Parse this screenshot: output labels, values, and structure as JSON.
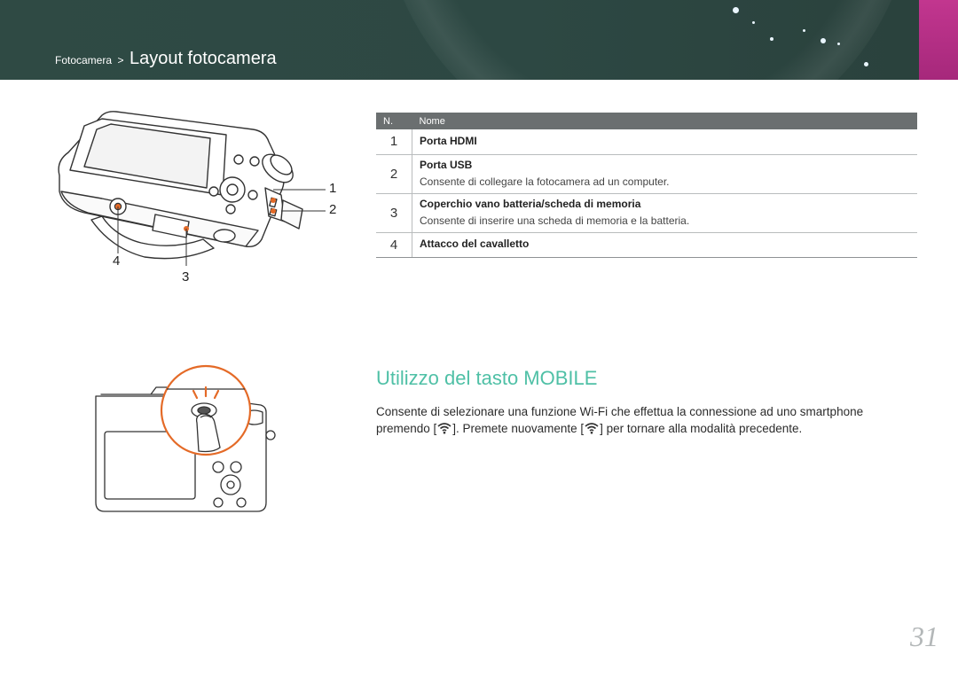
{
  "header": {
    "breadcrumb_parent": "Fotocamera",
    "breadcrumb_separator": ">",
    "title": "Layout fotocamera",
    "accent_color": "#b02f82",
    "band_color": "#2e4944"
  },
  "camera_callouts": {
    "c1": "1",
    "c2": "2",
    "c3": "3",
    "c4": "4"
  },
  "table": {
    "col_number": "N.",
    "col_name": "Nome",
    "rows": [
      {
        "number": "1",
        "name": "Porta HDMI",
        "description": ""
      },
      {
        "number": "2",
        "name": "Porta USB",
        "description": "Consente di collegare la fotocamera ad un computer."
      },
      {
        "number": "3",
        "name": "Coperchio vano batteria/scheda di memoria",
        "description": "Consente di inserire una scheda di memoria e la batteria."
      },
      {
        "number": "4",
        "name": "Attacco del cavalletto",
        "description": ""
      }
    ]
  },
  "section": {
    "title": "Utilizzo del tasto MOBILE",
    "title_color": "#4fc0a6",
    "text_part1": "Consente di selezionare una funzione Wi-Fi che effettua la connessione ad uno smartphone premendo [",
    "text_part2": "]. Premete nuovamente [",
    "text_part3": "] per tornare alla modalità precedente.",
    "icon": "wifi-icon"
  },
  "page_number": "31"
}
